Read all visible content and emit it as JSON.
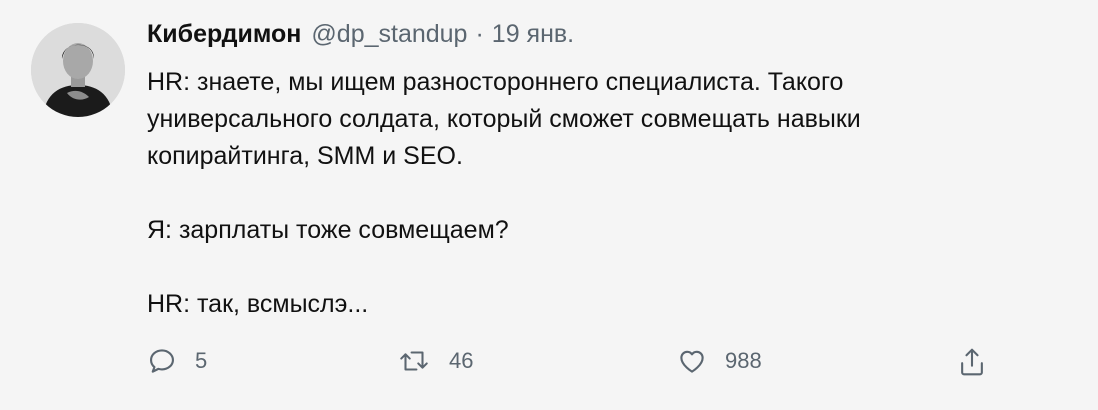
{
  "tweet": {
    "author_name": "Кибердимон",
    "handle": "@dp_standup",
    "separator": "·",
    "date": "19 янв.",
    "lines": [
      "HR: знаете, мы ищем разностороннего специалиста. Такого",
      "универсального солдата, который сможет совмещать навыки",
      "копирайтинга, SMM и SEO.",
      "Я: зарплаты тоже совмещаем?",
      "HR: так, всмыслэ..."
    ]
  },
  "actions": {
    "reply": {
      "icon": "reply-icon",
      "count": "5"
    },
    "retweet": {
      "icon": "retweet-icon",
      "count": "46"
    },
    "like": {
      "icon": "heart-icon",
      "count": "988"
    },
    "share": {
      "icon": "share-icon"
    }
  },
  "colors": {
    "background": "#f5f5f5",
    "text": "#111111",
    "secondary": "#5b6670"
  }
}
